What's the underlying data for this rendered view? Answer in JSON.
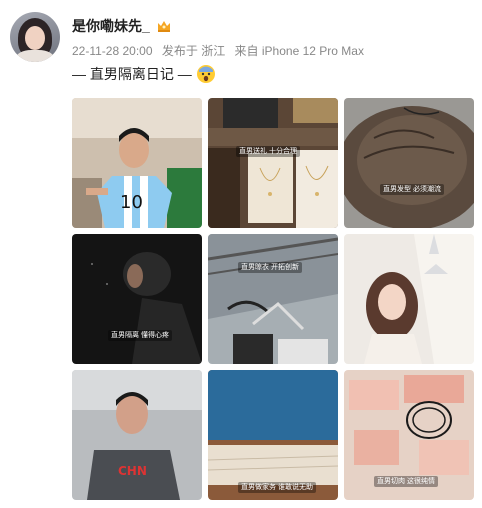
{
  "post": {
    "username": "是你嘞妹先_",
    "timestamp": "22-11-28 20:00",
    "location": "发布于 浙江",
    "source": "来自 iPhone 12 Pro Max",
    "text": "— 直男隔离日记 —"
  },
  "icons": {
    "badge": "crown-badge-icon",
    "emoji": "fearful-face-emoji-icon"
  },
  "images": [
    {
      "caption": ""
    },
    {
      "caption": "直男送礼 十分合理"
    },
    {
      "caption": "直男发型 必须潮流"
    },
    {
      "caption": "直男隔离 懂得心疼"
    },
    {
      "caption": "直男晾衣 开拓创新"
    },
    {
      "caption": ""
    },
    {
      "caption": ""
    },
    {
      "caption": "直男做家务 谁敢说无助"
    },
    {
      "caption": "直男切肉 这很纯情"
    }
  ],
  "colors": {
    "accent": "#f5a623",
    "meta_text": "#888888",
    "username": "#222222"
  }
}
